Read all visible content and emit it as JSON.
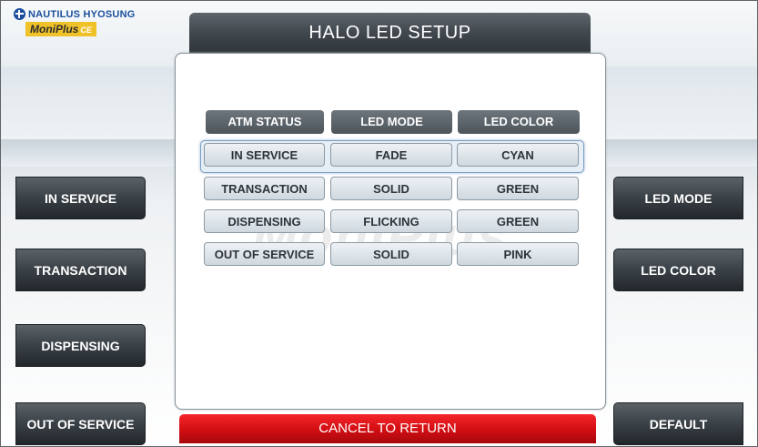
{
  "brand": {
    "company": "NAUTILUS HYOSUNG",
    "product": "MoniPlus",
    "product_suffix": "CE"
  },
  "title": "HALO LED SETUP",
  "watermark": "MoniPlus",
  "table": {
    "headers": [
      "ATM STATUS",
      "LED MODE",
      "LED COLOR"
    ],
    "rows": [
      {
        "status": "IN SERVICE",
        "mode": "FADE",
        "color": "CYAN"
      },
      {
        "status": "TRANSACTION",
        "mode": "SOLID",
        "color": "GREEN"
      },
      {
        "status": "DISPENSING",
        "mode": "FLICKING",
        "color": "GREEN"
      },
      {
        "status": "OUT OF SERVICE",
        "mode": "SOLID",
        "color": "PINK"
      }
    ],
    "selected_row": 0
  },
  "left_buttons": [
    "IN SERVICE",
    "TRANSACTION",
    "DISPENSING",
    "OUT OF SERVICE"
  ],
  "right_buttons": [
    "LED MODE",
    "LED COLOR",
    "DEFAULT"
  ],
  "cancel_label": "CANCEL TO RETURN",
  "colors": {
    "brand_blue": "#1b4f9c",
    "cancel_red": "#d40f14",
    "highlight": "#7c9ec3"
  }
}
